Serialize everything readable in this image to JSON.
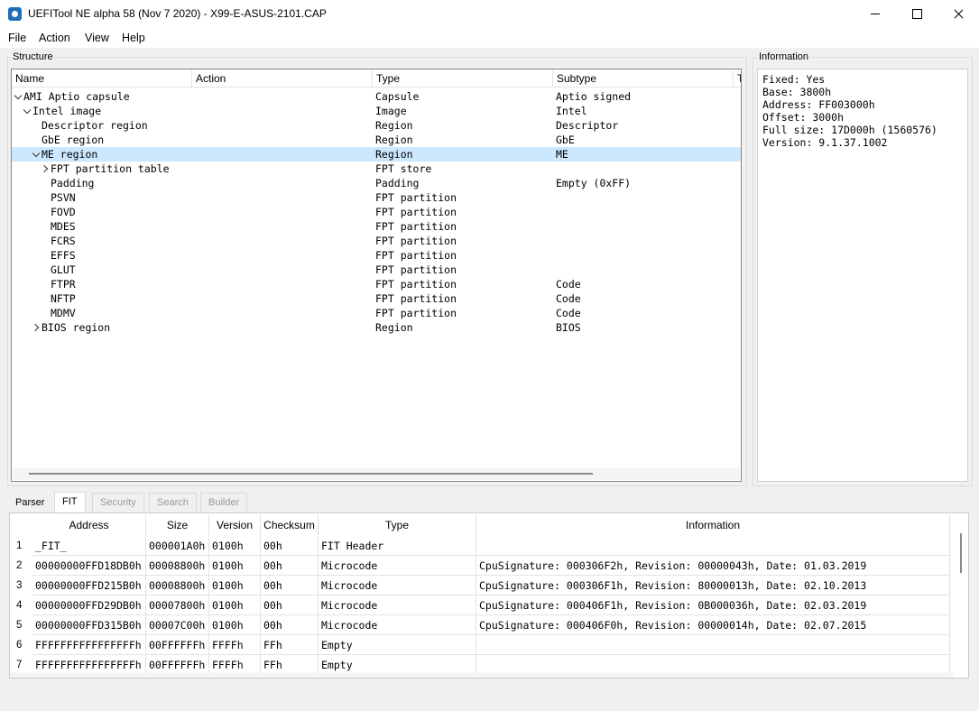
{
  "window": {
    "title": "UEFITool NE alpha 58 (Nov  7 2020) - X99-E-ASUS-2101.CAP",
    "icon": "uefitool-gear-icon"
  },
  "menu": [
    "File",
    "Action",
    "View",
    "Help"
  ],
  "structure": {
    "label": "Structure",
    "columns": [
      "Name",
      "Action",
      "Type",
      "Subtype",
      "T"
    ],
    "rows": [
      {
        "name": "AMI Aptio capsule",
        "type": "Capsule",
        "subtype": "Aptio signed",
        "expander": "down",
        "indent": 0
      },
      {
        "name": "Intel image",
        "type": "Image",
        "subtype": "Intel",
        "expander": "down",
        "indent": 1
      },
      {
        "name": "Descriptor region",
        "type": "Region",
        "subtype": "Descriptor",
        "expander": "",
        "indent": 2
      },
      {
        "name": "GbE region",
        "type": "Region",
        "subtype": "GbE",
        "expander": "",
        "indent": 2
      },
      {
        "name": "ME region",
        "type": "Region",
        "subtype": "ME",
        "expander": "down",
        "indent": 2,
        "selected": true
      },
      {
        "name": "FPT partition table",
        "type": "FPT store",
        "subtype": "",
        "expander": "right",
        "indent": 3
      },
      {
        "name": "Padding",
        "type": "Padding",
        "subtype": "Empty (0xFF)",
        "expander": "",
        "indent": 3
      },
      {
        "name": "PSVN",
        "type": "FPT partition",
        "subtype": "",
        "expander": "",
        "indent": 3
      },
      {
        "name": "FOVD",
        "type": "FPT partition",
        "subtype": "",
        "expander": "",
        "indent": 3
      },
      {
        "name": "MDES",
        "type": "FPT partition",
        "subtype": "",
        "expander": "",
        "indent": 3
      },
      {
        "name": "FCRS",
        "type": "FPT partition",
        "subtype": "",
        "expander": "",
        "indent": 3
      },
      {
        "name": "EFFS",
        "type": "FPT partition",
        "subtype": "",
        "expander": "",
        "indent": 3
      },
      {
        "name": "GLUT",
        "type": "FPT partition",
        "subtype": "",
        "expander": "",
        "indent": 3
      },
      {
        "name": "FTPR",
        "type": "FPT partition",
        "subtype": "Code",
        "expander": "",
        "indent": 3
      },
      {
        "name": "NFTP",
        "type": "FPT partition",
        "subtype": "Code",
        "expander": "",
        "indent": 3
      },
      {
        "name": "MDMV",
        "type": "FPT partition",
        "subtype": "Code",
        "expander": "",
        "indent": 3
      },
      {
        "name": "BIOS region",
        "type": "Region",
        "subtype": "BIOS",
        "expander": "right",
        "indent": 2
      }
    ]
  },
  "information": {
    "label": "Information",
    "lines": [
      "Fixed: Yes",
      "Base: 3800h",
      "Address: FF003000h",
      "Offset: 3000h",
      "Full size: 17D000h (1560576)",
      "Version: 9.1.37.1002"
    ]
  },
  "tabs": [
    {
      "label": "Parser",
      "state": "normal"
    },
    {
      "label": "FIT",
      "state": "active"
    },
    {
      "label": "Security",
      "state": "disabled"
    },
    {
      "label": "Search",
      "state": "disabled"
    },
    {
      "label": "Builder",
      "state": "disabled"
    }
  ],
  "fit": {
    "columns": [
      "Address",
      "Size",
      "Version",
      "Checksum",
      "Type",
      "Information"
    ],
    "rows": [
      {
        "n": "1",
        "address": "_FIT_",
        "size": "000001A0h",
        "version": "0100h",
        "checksum": "00h",
        "type": "FIT Header",
        "info": ""
      },
      {
        "n": "2",
        "address": "00000000FFD18DB0h",
        "size": "00008800h",
        "version": "0100h",
        "checksum": "00h",
        "type": "Microcode",
        "info": "CpuSignature: 000306F2h, Revision: 00000043h, Date: 01.03.2019"
      },
      {
        "n": "3",
        "address": "00000000FFD215B0h",
        "size": "00008800h",
        "version": "0100h",
        "checksum": "00h",
        "type": "Microcode",
        "info": "CpuSignature: 000306F1h, Revision: 80000013h, Date: 02.10.2013"
      },
      {
        "n": "4",
        "address": "00000000FFD29DB0h",
        "size": "00007800h",
        "version": "0100h",
        "checksum": "00h",
        "type": "Microcode",
        "info": "CpuSignature: 000406F1h, Revision: 0B000036h, Date: 02.03.2019"
      },
      {
        "n": "5",
        "address": "00000000FFD315B0h",
        "size": "00007C00h",
        "version": "0100h",
        "checksum": "00h",
        "type": "Microcode",
        "info": "CpuSignature: 000406F0h, Revision: 00000014h, Date: 02.07.2015"
      },
      {
        "n": "6",
        "address": "FFFFFFFFFFFFFFFFh",
        "size": "00FFFFFFh",
        "version": "FFFFh",
        "checksum": "FFh",
        "type": "Empty",
        "info": ""
      },
      {
        "n": "7",
        "address": "FFFFFFFFFFFFFFFFh",
        "size": "00FFFFFFh",
        "version": "FFFFh",
        "checksum": "FFh",
        "type": "Empty",
        "info": ""
      }
    ]
  }
}
